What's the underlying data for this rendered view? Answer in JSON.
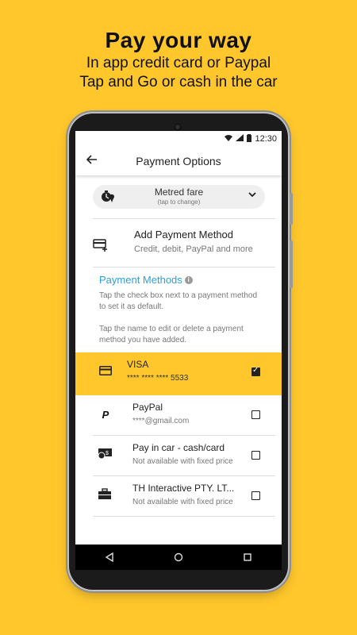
{
  "promo": {
    "title": "Pay your way",
    "line1": "In app credit card or Paypal",
    "line2": "Tap and Go or cash in the car"
  },
  "status_bar": {
    "time": "12:30",
    "icons": [
      "wifi-icon",
      "signal-icon",
      "battery-icon"
    ]
  },
  "app_bar": {
    "title": "Payment Options",
    "back_icon": "back-arrow-icon"
  },
  "fare": {
    "label": "Metred fare",
    "sublabel": "(tap to change)",
    "icon": "timer-pin-icon",
    "chevron": "chevron-down-icon"
  },
  "add_method": {
    "title": "Add Payment Method",
    "subtitle": "Credit, debit, PayPal and more",
    "icon": "add-card-icon"
  },
  "payment_methods": {
    "header": "Payment Methods",
    "help1": "Tap the check box next to a payment method to set it as default.",
    "help2": "Tap the name to edit or delete a payment method you have added."
  },
  "methods": [
    {
      "name": "VISA",
      "detail": "**** **** **** 5533",
      "icon": "card-icon",
      "checked": true,
      "selected": true
    },
    {
      "name": "PayPal",
      "detail": "****@gmail.com",
      "icon": "paypal-icon",
      "checked": false,
      "selected": false
    },
    {
      "name": "Pay in car - cash/card",
      "detail": "Not available with fixed price",
      "icon": "cash-icon",
      "checked": false,
      "selected": false
    },
    {
      "name": "TH Interactive PTY. LT...",
      "detail": "Not available with fixed price",
      "icon": "briefcase-icon",
      "checked": false,
      "selected": false
    }
  ],
  "colors": {
    "accent": "#FFC72C",
    "link": "#2e9fd6",
    "text": "#222222"
  }
}
